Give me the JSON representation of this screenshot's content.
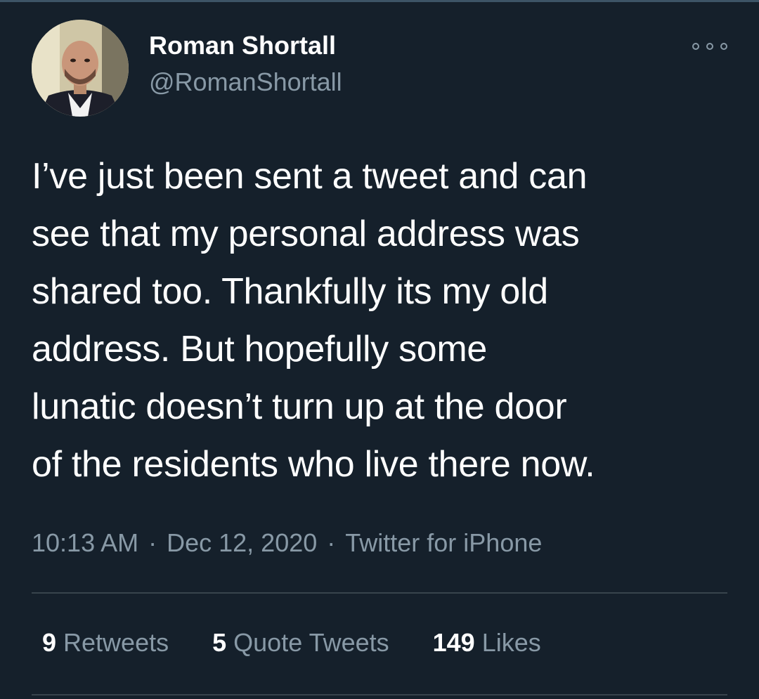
{
  "tweet": {
    "author": {
      "display_name": "Roman Shortall",
      "handle": "@RomanShortall"
    },
    "text_lines": [
      "I’ve just been sent a tweet and can",
      "see that my personal address was",
      "shared too. Thankfully its my old",
      "address. But hopefully some",
      "lunatic doesn’t turn up at the door",
      "of the residents who live there now."
    ],
    "time": "10:13 AM",
    "separator": "·",
    "date": "Dec 12, 2020",
    "source": "Twitter for iPhone",
    "stats": {
      "retweets_count": "9",
      "retweets_label": "Retweets",
      "quote_tweets_count": "5",
      "quote_tweets_label": "Quote Tweets",
      "likes_count": "149",
      "likes_label": "Likes"
    }
  },
  "icons": {
    "more": "more-horizontal-icon"
  },
  "colors": {
    "background": "#15202b",
    "primary_text": "#ffffff",
    "secondary_text": "#8899a6",
    "divider": "#38444d"
  }
}
